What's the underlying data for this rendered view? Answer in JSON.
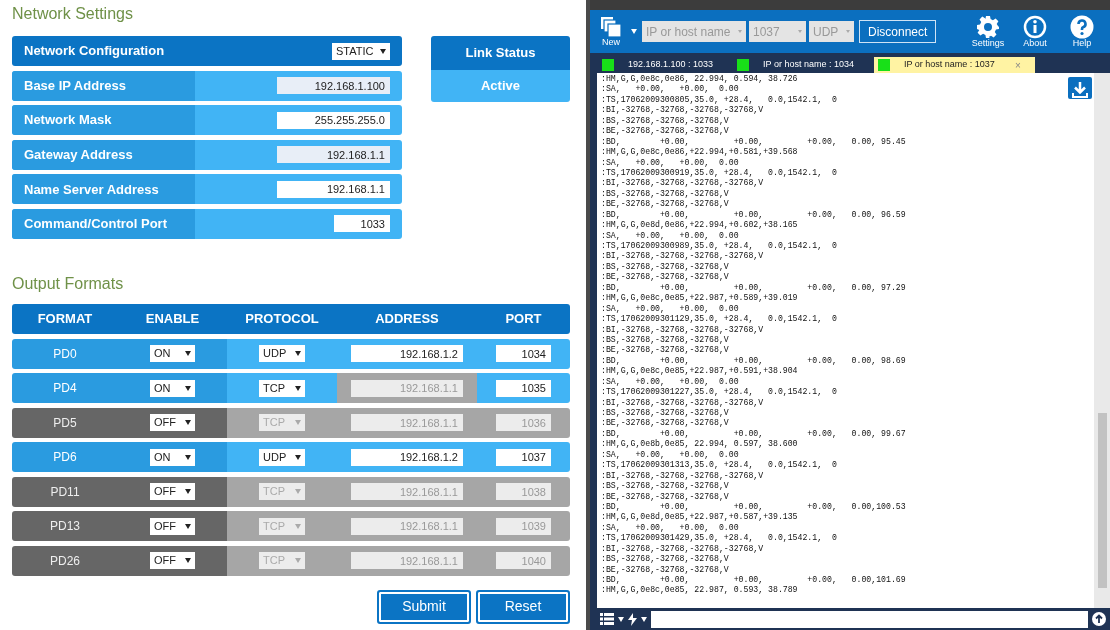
{
  "network_settings": {
    "title": "Network Settings",
    "configuration": {
      "label": "Network Configuration",
      "value": "STATIC"
    },
    "fields": [
      {
        "label": "Base IP Address",
        "value": "192.168.1.100",
        "disabled": true
      },
      {
        "label": "Network Mask",
        "value": "255.255.255.0",
        "disabled": false
      },
      {
        "label": "Gateway Address",
        "value": "192.168.1.1",
        "disabled": true
      },
      {
        "label": "Name Server Address",
        "value": "192.168.1.1",
        "disabled": false
      },
      {
        "label": "Command/Control Port",
        "value": "1033",
        "disabled": false,
        "kind": "port"
      }
    ],
    "link_status": {
      "label": "Link Status",
      "value": "Active"
    }
  },
  "output_formats": {
    "title": "Output Formats",
    "columns": [
      "FORMAT",
      "ENABLE",
      "PROTOCOL",
      "ADDRESS",
      "PORT"
    ],
    "rows": [
      {
        "format": "PD0",
        "enable": "ON",
        "enabled": true,
        "protocol": "UDP",
        "address": "192.168.1.2",
        "address_disabled": false,
        "port": "1034"
      },
      {
        "format": "PD4",
        "enable": "ON",
        "enabled": true,
        "protocol": "TCP",
        "address": "192.168.1.1",
        "address_disabled": true,
        "port": "1035"
      },
      {
        "format": "PD5",
        "enable": "OFF",
        "enabled": false,
        "protocol": "TCP",
        "address": "192.168.1.1",
        "address_disabled": true,
        "port": "1036"
      },
      {
        "format": "PD6",
        "enable": "ON",
        "enabled": true,
        "protocol": "UDP",
        "address": "192.168.1.2",
        "address_disabled": false,
        "port": "1037"
      },
      {
        "format": "PD11",
        "enable": "OFF",
        "enabled": false,
        "protocol": "TCP",
        "address": "192.168.1.1",
        "address_disabled": true,
        "port": "1038"
      },
      {
        "format": "PD13",
        "enable": "OFF",
        "enabled": false,
        "protocol": "TCP",
        "address": "192.168.1.1",
        "address_disabled": true,
        "port": "1039"
      },
      {
        "format": "PD26",
        "enable": "OFF",
        "enabled": false,
        "protocol": "TCP",
        "address": "192.168.1.1",
        "address_disabled": true,
        "port": "1040"
      }
    ],
    "buttons": [
      "Submit",
      "Reset"
    ]
  },
  "app": {
    "toolbar": {
      "new_label": "New",
      "host": "IP or host name",
      "port": "1037",
      "protocol": "UDP",
      "connect_button": "Disconnect",
      "actions": [
        {
          "kind": "settings",
          "label": "Settings"
        },
        {
          "kind": "about",
          "label": "About"
        },
        {
          "kind": "help",
          "label": "Help"
        }
      ]
    },
    "tabs": [
      {
        "label": "192.168.1.100 : 1033",
        "selected": false
      },
      {
        "label": "IP or host name : 1034",
        "selected": false
      },
      {
        "label": "IP or host name : 1037",
        "selected": true,
        "close": "×"
      }
    ],
    "terminal": {
      "lines": [
        ":HM,G,G,0e8c,0e86, 22.994, 0.594, 38.726",
        ":SA,   +0.00,   +0.00,  0.00",
        ":TS,17062009300805,35.0, +28.4,   0.0,1542.1,  0",
        ":BI,-32768,-32768,-32768,-32768,V",
        ":BS,-32768,-32768,-32768,V",
        ":BE,-32768,-32768,-32768,V",
        ":BD,        +0.00,         +0.00,         +0.00,   0.00, 95.45",
        ":HM,G,G,0e8c,0e86,+22.994,+0.581,+39.568",
        ":SA,   +0.00,   +0.00,  0.00",
        ":TS,17062009300919,35.0, +28.4,   0.0,1542.1,  0",
        ":BI,-32768,-32768,-32768,-32768,V",
        ":BS,-32768,-32768,-32768,V",
        ":BE,-32768,-32768,-32768,V",
        ":BD,        +0.00,         +0.00,         +0.00,   0.00, 96.59",
        ":HM,G,G,0e8d,0e86,+22.994,+0.602,+38.165",
        ":SA,   +0.00,   +0.00,  0.00",
        ":TS,17062009300989,35.0, +28.4,   0.0,1542.1,  0",
        ":BI,-32768,-32768,-32768,-32768,V",
        ":BS,-32768,-32768,-32768,V",
        ":BE,-32768,-32768,-32768,V",
        ":BD,        +0.00,         +0.00,         +0.00,   0.00, 97.29",
        ":HM,G,G,0e8c,0e85,+22.987,+0.589,+39.019",
        ":SA,   +0.00,   +0.00,  0.00",
        ":TS,17062009301129,35.0, +28.4,   0.0,1542.1,  0",
        ":BI,-32768,-32768,-32768,-32768,V",
        ":BS,-32768,-32768,-32768,V",
        ":BE,-32768,-32768,-32768,V",
        ":BD,        +0.00,         +0.00,         +0.00,   0.00, 98.69",
        ":HM,G,G,0e8c,0e85,+22.987,+0.591,+38.904",
        ":SA,   +0.00,   +0.00,  0.00",
        ":TS,17062009301227,35.0, +28.4,   0.0,1542.1,  0",
        ":BI,-32768,-32768,-32768,-32768,V",
        ":BS,-32768,-32768,-32768,V",
        ":BE,-32768,-32768,-32768,V",
        ":BD,        +0.00,         +0.00,         +0.00,   0.00, 99.67",
        ":HM,G,G,0e8b,0e85, 22.994, 0.597, 38.600",
        ":SA,   +0.00,   +0.00,  0.00",
        ":TS,17062009301313,35.0, +28.4,   0.0,1542.1,  0",
        ":BI,-32768,-32768,-32768,-32768,V",
        ":BS,-32768,-32768,-32768,V",
        ":BE,-32768,-32768,-32768,V",
        ":BD,        +0.00,         +0.00,         +0.00,   0.00,100.53",
        ":HM,G,G,0e8d,0e85,+22.987,+0.587,+39.135",
        ":SA,   +0.00,   +0.00,  0.00",
        ":TS,17062009301429,35.0, +28.4,   0.0,1542.1,  0",
        ":BI,-32768,-32768,-32768,-32768,V",
        ":BS,-32768,-32768,-32768,V",
        ":BE,-32768,-32768,-32768,V",
        ":BD,        +0.00,         +0.00,         +0.00,   0.00,101.69",
        ":HM,G,G,0e8c,0e85, 22.987, 0.593, 38.789"
      ]
    }
  }
}
